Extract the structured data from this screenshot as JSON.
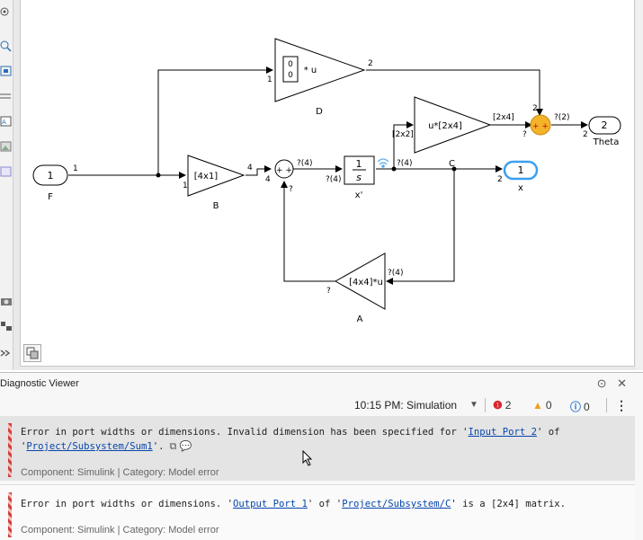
{
  "diagram": {
    "blocks": {
      "F": {
        "port": "1",
        "name": "F"
      },
      "B": {
        "gain": "[4x1]",
        "name": "B"
      },
      "D": {
        "matrix": [
          "0",
          "0"
        ],
        "suffix": "* u",
        "name": "D"
      },
      "integrator": {
        "num": "1",
        "den": "s",
        "name": "x'"
      },
      "E": {
        "gain": "u*[2x4]"
      },
      "A": {
        "gain": "[4x4]*u",
        "name": "A"
      },
      "x": {
        "port": "1",
        "name": "x"
      },
      "Theta": {
        "port": "2",
        "name": "Theta"
      },
      "sum_left_signs": "+ +",
      "sum_right_signs": "+ +"
    },
    "labels": {
      "F_out": "1",
      "branch_in_D": "1",
      "branch_in_B": "1",
      "D_out": "2",
      "B_out": "4",
      "sum_in": "4",
      "sum_q": "?",
      "sum_out_dim": "?(4)",
      "int_in_dim": "?(4)",
      "int_out_dim": "?(4)",
      "int_2x2": "[2x2]",
      "E_out": "[2x4]",
      "sum2_in_q": "?",
      "sum2_top": "2",
      "sum2_out": "?(2)",
      "theta_in": "2",
      "C": "C",
      "x_in": "2",
      "A_in": "?(4)",
      "A_out": "?"
    }
  },
  "diagnostic_viewer": {
    "title": "Diagnostic Viewer",
    "time_label": "10:15 PM: Simulation",
    "errors": "2",
    "warnings": "0",
    "infos": "0",
    "messages": [
      {
        "text_a": "Error in port widths or dimensions. Invalid dimension has been specified for '",
        "link_a": "Input Port 2",
        "text_b": "' of",
        "line2_a": "'",
        "link_b": "Project/Subsystem/Sum1",
        "line2_b": "'.",
        "component": "Component: Simulink | Category: Model error"
      },
      {
        "text_a": "Error in port widths or dimensions. '",
        "link_a": "Output Port 1",
        "text_b": "' of '",
        "link_b": "Project/Subsystem/C",
        "text_c": "' is a [2x4] matrix.",
        "component": "Component: Simulink | Category: Model error"
      }
    ]
  },
  "colors": {
    "sum_highlight": "#f5b32a",
    "error_red": "#d9262c",
    "warning_orange": "#f0a020",
    "info_blue": "#2b76d2",
    "port_highlight": "#3aa0f0"
  }
}
